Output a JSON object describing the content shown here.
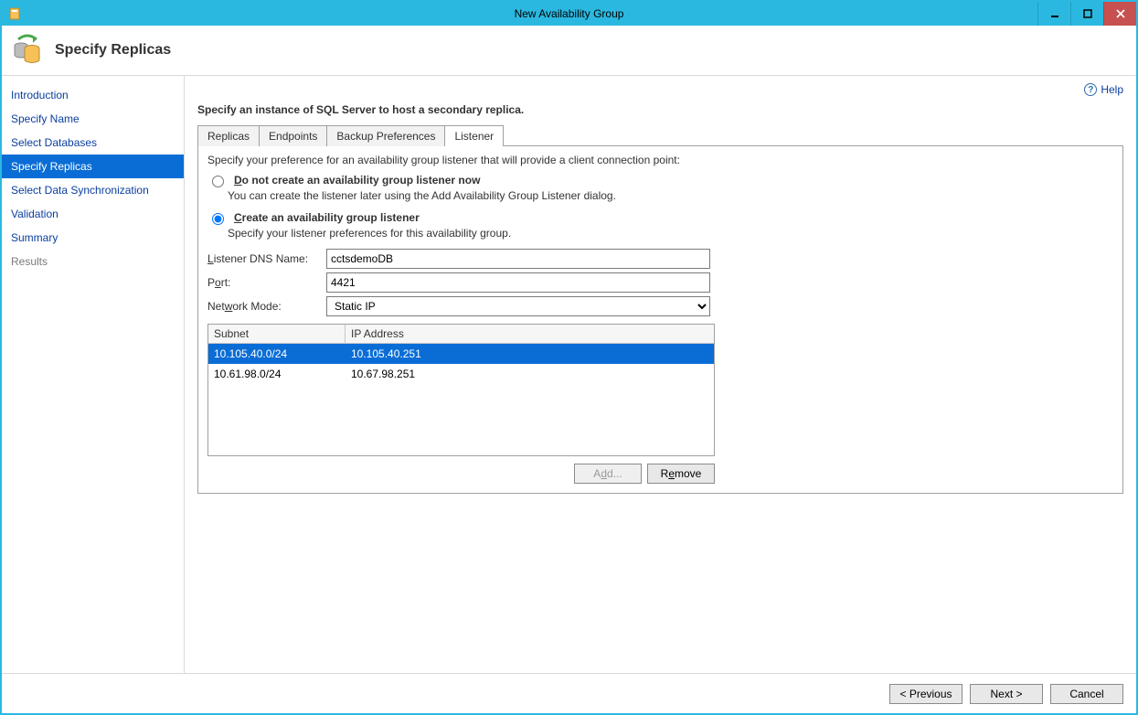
{
  "window": {
    "title": "New Availability Group"
  },
  "header": {
    "title": "Specify Replicas"
  },
  "help": {
    "label": "Help"
  },
  "sidebar": {
    "items": [
      {
        "label": "Introduction",
        "state": "link"
      },
      {
        "label": "Specify Name",
        "state": "link"
      },
      {
        "label": "Select Databases",
        "state": "link"
      },
      {
        "label": "Specify Replicas",
        "state": "selected"
      },
      {
        "label": "Select Data Synchronization",
        "state": "link"
      },
      {
        "label": "Validation",
        "state": "link"
      },
      {
        "label": "Summary",
        "state": "link"
      },
      {
        "label": "Results",
        "state": "disabled"
      }
    ]
  },
  "main": {
    "instruction": "Specify an instance of SQL Server to host a secondary replica.",
    "tabs": [
      {
        "label": "Replicas"
      },
      {
        "label": "Endpoints"
      },
      {
        "label": "Backup Preferences"
      },
      {
        "label": "Listener"
      }
    ],
    "active_tab": "Listener",
    "panel": {
      "description": "Specify your preference for an availability group listener that will provide a client connection point:",
      "radio_no": {
        "label": "Do not create an availability group listener now",
        "sub": "You can create the listener later using the Add Availability Group Listener dialog."
      },
      "radio_yes": {
        "label": "Create an availability group listener",
        "sub": "Specify your listener preferences for this availability group."
      },
      "selected_radio": "yes",
      "fields": {
        "dns_label": "Listener DNS Name:",
        "dns_value": "cctsdemoDB",
        "port_label": "Port:",
        "port_value": "4421",
        "mode_label": "Network Mode:",
        "mode_value": "Static IP"
      },
      "grid": {
        "headers": {
          "subnet": "Subnet",
          "ip": "IP Address"
        },
        "rows": [
          {
            "subnet": "10.105.40.0/24",
            "ip": "10.105.40.251",
            "selected": true
          },
          {
            "subnet": "10.61.98.0/24",
            "ip": "10.67.98.251",
            "selected": false
          }
        ],
        "add_label": "Add...",
        "remove_label": "Remove"
      }
    }
  },
  "footer": {
    "previous": "< Previous",
    "next": "Next >",
    "cancel": "Cancel"
  }
}
